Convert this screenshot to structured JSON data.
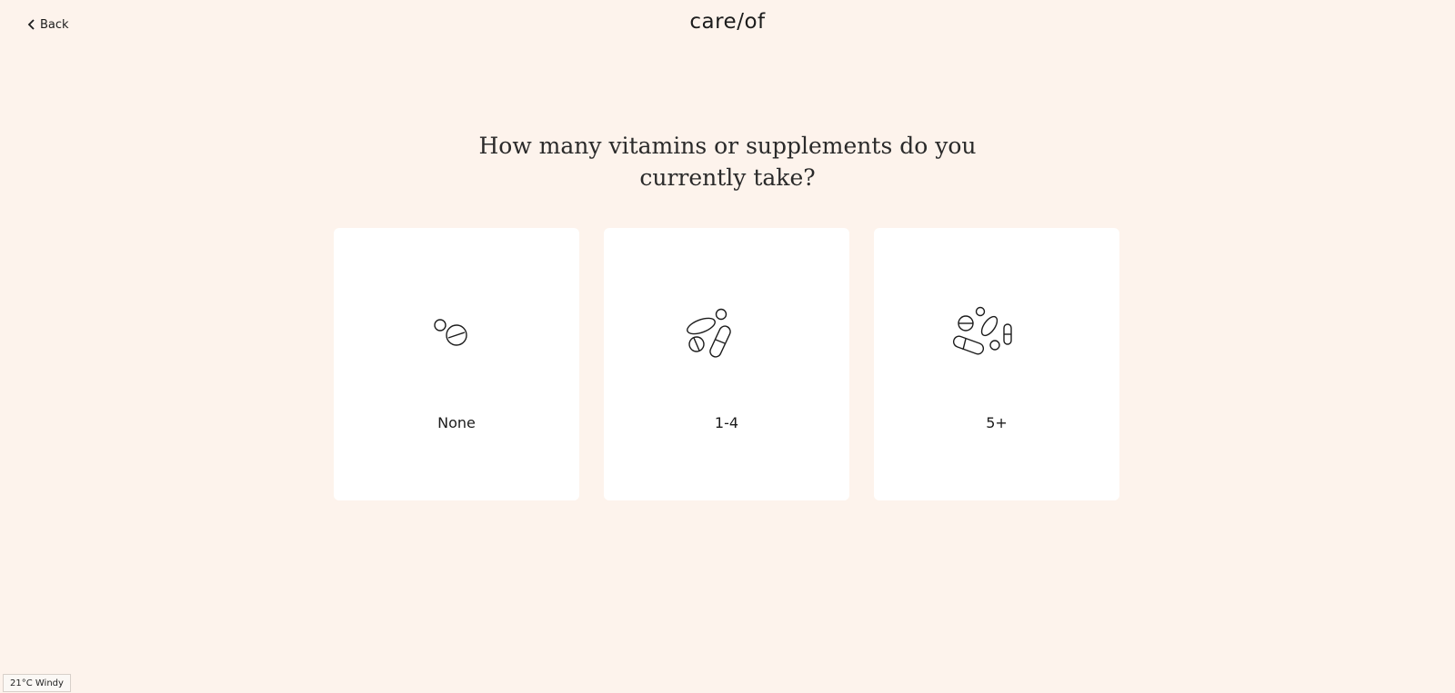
{
  "header": {
    "back_label": "Back",
    "logo_text": "care/of"
  },
  "question": {
    "title": "How many vitamins or supplements do you currently take?"
  },
  "options": [
    {
      "label": "None",
      "icon": "two-pills-icon"
    },
    {
      "label": "1-4",
      "icon": "four-pills-icon"
    },
    {
      "label": "5+",
      "icon": "many-pills-icon"
    }
  ],
  "status_bar": {
    "weather": "21°C Windy"
  }
}
